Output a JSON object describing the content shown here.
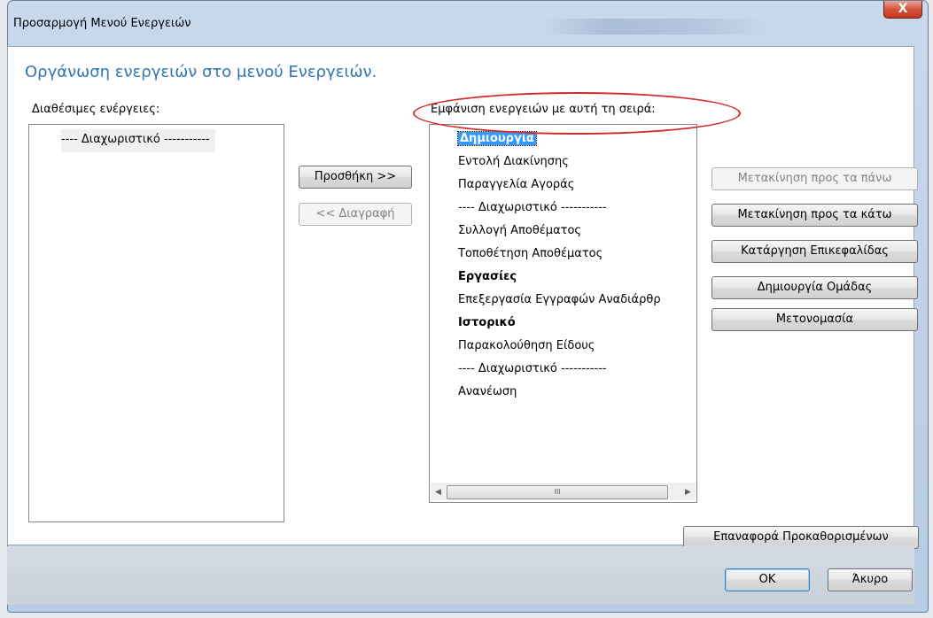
{
  "window": {
    "title": "Προσαρμογή Μενού Ενεργειών",
    "close_symbol": "X"
  },
  "heading": "Οργάνωση ενεργειών στο μενού Ενεργειών.",
  "available": {
    "label": "Διαθέσιμες ενέργειες:",
    "items": [
      "---- Διαχωριστικό -----------"
    ]
  },
  "ordered": {
    "label": "Εμφάνιση ενεργειών με αυτή τη σειρά:",
    "items": [
      "Δημιουργία",
      "Εντολή Διακίνησης",
      "Παραγγελία Αγοράς",
      "---- Διαχωριστικό -----------",
      "Συλλογή Αποθέματος",
      "Τοποθέτηση Αποθέματος",
      "Εργασίες",
      "Επεξεργασία Εγγραφών Αναδιάρθρ",
      "Ιστορικό",
      "Παρακολούθηση Είδους",
      "---- Διαχωριστικό -----------",
      "Ανανέωση"
    ],
    "selected_index": 0,
    "bold_indices": [
      0,
      6,
      8
    ]
  },
  "buttons": {
    "add": "Προσθήκη >>",
    "remove": "<< Διαγραφή",
    "move_up": "Μετακίνηση προς τα πάνω",
    "move_down": "Μετακίνηση προς τα κάτω",
    "remove_header": "Κατάργηση Επικεφαλίδας",
    "create_group": "Δημιουργία Ομάδας",
    "rename": "Μετονομασία",
    "reset_defaults": "Επαναφορά Προκαθορισμένων",
    "ok": "OK",
    "cancel": "Άκυρο"
  },
  "scrollbar": {
    "left_arrow": "◀",
    "right_arrow": "▶",
    "grip": "III"
  },
  "colors": {
    "heading": "#2f74b5",
    "selection": "#3399ff",
    "annotation_ellipse": "#d42a2a"
  }
}
